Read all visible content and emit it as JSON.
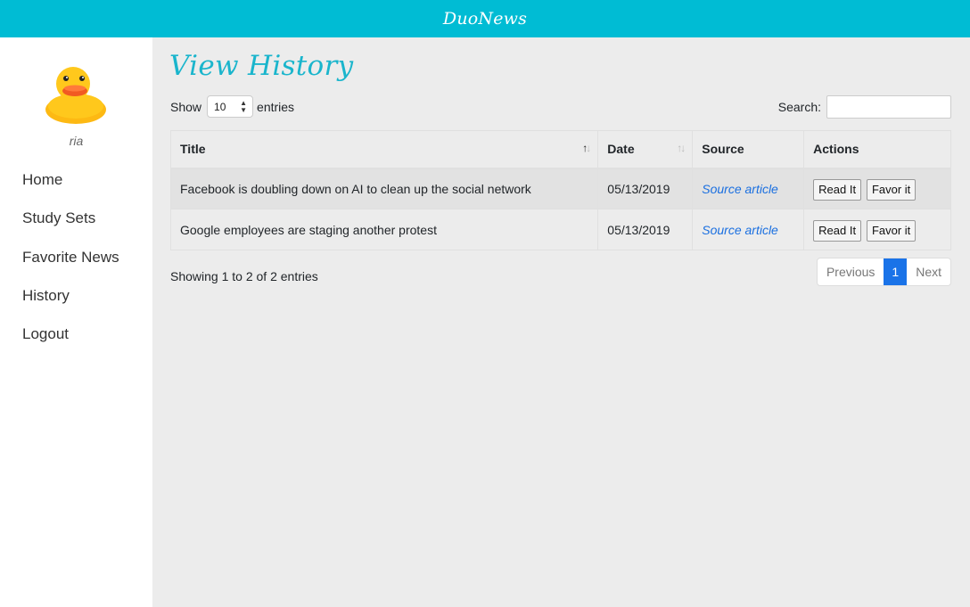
{
  "header": {
    "brand": "DuoNews"
  },
  "sidebar": {
    "username": "ria",
    "items": [
      {
        "label": "Home"
      },
      {
        "label": "Study Sets"
      },
      {
        "label": "Favorite News"
      },
      {
        "label": "History"
      },
      {
        "label": "Logout"
      }
    ]
  },
  "main": {
    "title": "View History",
    "length": {
      "show": "Show",
      "value": "10",
      "entries": "entries"
    },
    "search": {
      "label": "Search:",
      "value": ""
    },
    "table": {
      "columns": [
        "Title",
        "Date",
        "Source",
        "Actions"
      ],
      "rows": [
        {
          "title": "Facebook is doubling down on AI to clean up the social network",
          "date": "05/13/2019",
          "source": "Source article",
          "read": "Read It",
          "favor": "Favor it"
        },
        {
          "title": "Google employees are staging another protest",
          "date": "05/13/2019",
          "source": "Source article",
          "read": "Read It",
          "favor": "Favor it"
        }
      ]
    },
    "info": "Showing 1 to 2 of 2 entries",
    "pagination": {
      "previous": "Previous",
      "current": "1",
      "next": "Next"
    }
  },
  "colors": {
    "accent": "#00bcd4",
    "title": "#1ab5cc",
    "link": "#1a6fe0",
    "page_active": "#1a73e8"
  },
  "icons": {
    "avatar": "rubber-duck-icon",
    "sort": "sort-arrows-icon",
    "select": "select-arrows-icon"
  }
}
